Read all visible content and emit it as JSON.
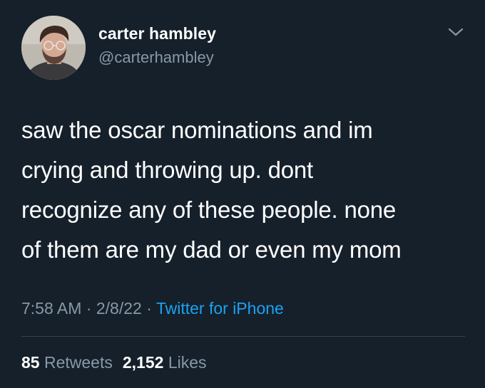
{
  "user": {
    "display_name": "carter hambley",
    "handle": "@carterhambley",
    "avatar_icon": "profile-photo"
  },
  "menu_icon": "chevron-down-icon",
  "tweet": {
    "text": "saw the oscar nominations and im\ncrying and throwing up. dont\nrecognize any of these people. none\nof them are my dad or even my mom",
    "time": "7:58 AM",
    "separator": "·",
    "date": "2/8/22",
    "source": "Twitter for iPhone"
  },
  "stats": {
    "retweets_count": "85",
    "retweets_label": "Retweets",
    "likes_count": "2,152",
    "likes_label": "Likes"
  },
  "colors": {
    "background": "#15202b",
    "primary_text": "#ffffff",
    "secondary_text": "#8899a6",
    "link": "#1da1f2",
    "divider": "#38444d"
  }
}
